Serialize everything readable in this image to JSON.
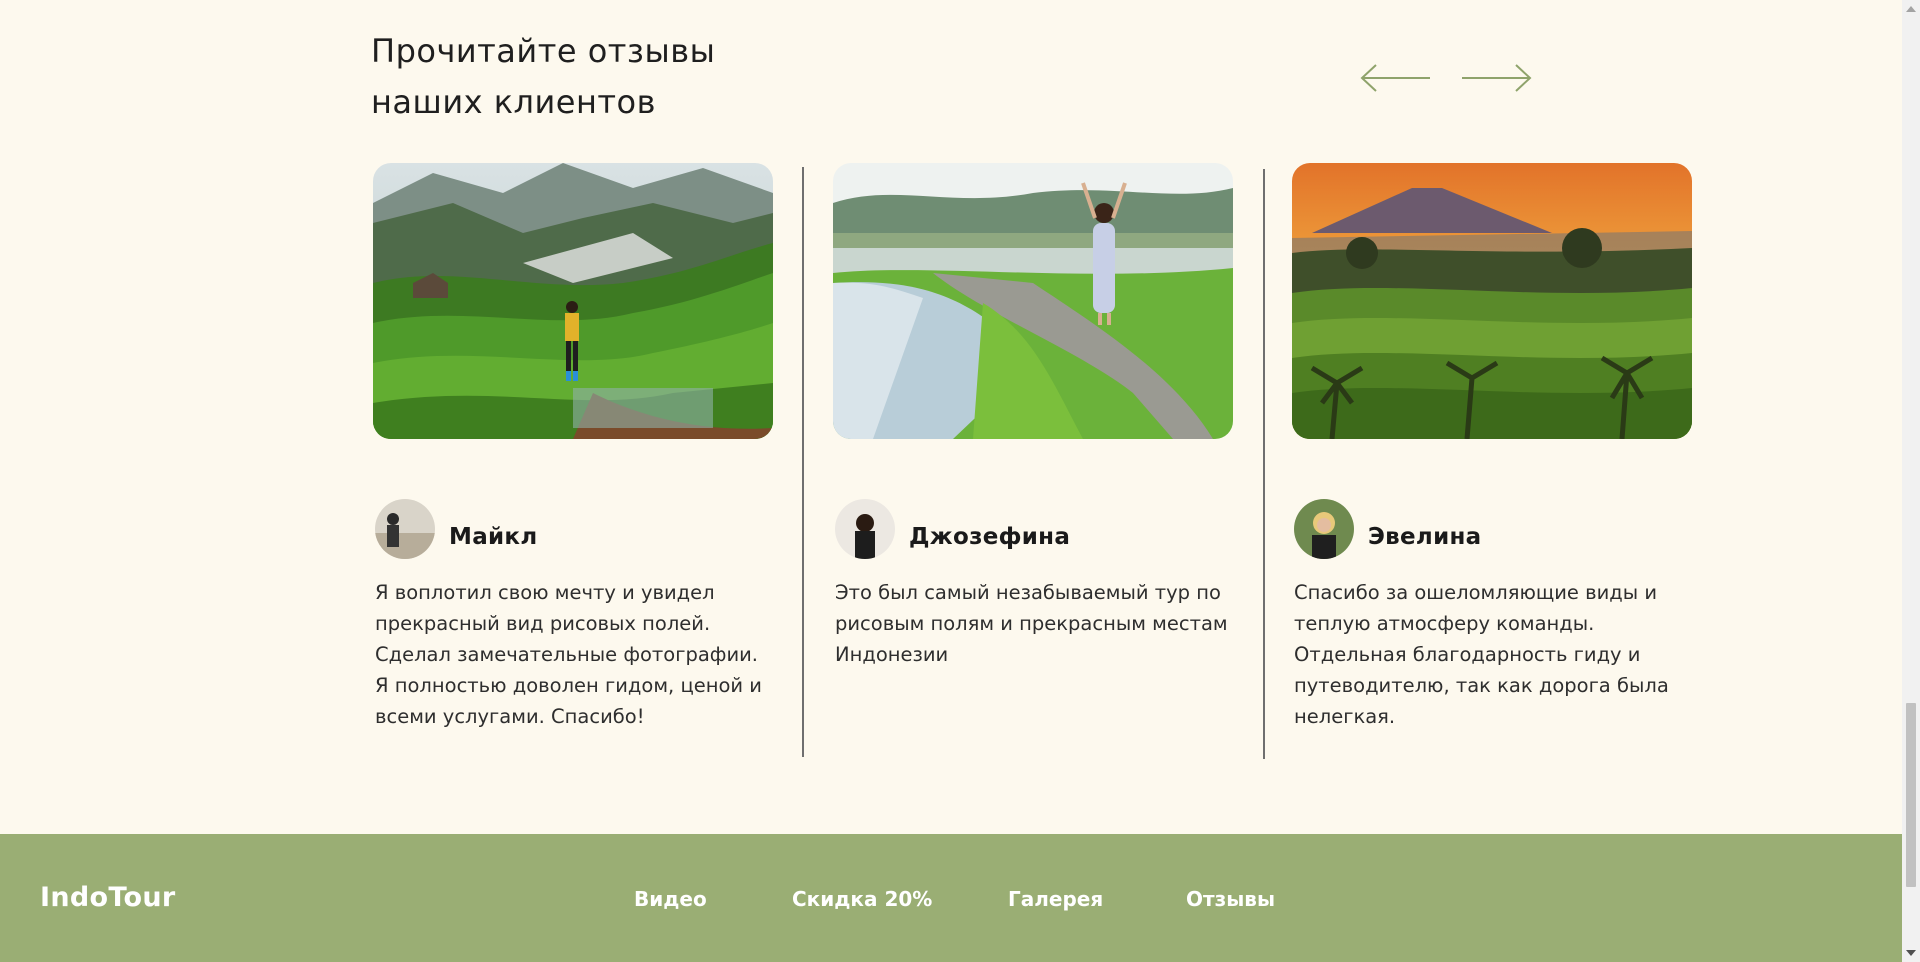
{
  "reviews": {
    "heading_line1": "Прочитайте отзывы",
    "heading_line2": "наших клиентов",
    "arrow_color": "#8fa36b",
    "items": [
      {
        "name": "Майкл",
        "text": "Я воплотил свою мечту и увидел прекрасный вид рисовых полей. Сделал замечательные фотографии. Я полностью доволен гидом, ценой и всеми услугами. Спасибо!",
        "image": "rice-terraces-traveler-photo",
        "avatar": "michael-avatar"
      },
      {
        "name": "Джозефина",
        "text": "Это был самый незабываемый тур по рисовым полям и прекрасным местам Индонезии",
        "image": "rice-field-woman-jumping-photo",
        "avatar": "josephine-avatar"
      },
      {
        "name": "Эвелина",
        "text": "Спасибо за ошеломляющие виды и теплую атмосферу команды. Отдельная благодарность гиду и путеводителю, так как дорога была нелегкая.",
        "image": "sunset-volcano-terraces-photo",
        "avatar": "evelina-avatar"
      }
    ]
  },
  "footer": {
    "logo": "IndoTour",
    "background": "#9aae74",
    "nav": [
      "Видео",
      "Скидка 20%",
      "Галерея",
      "Отзывы"
    ]
  },
  "page_background": "#fdf9ee"
}
